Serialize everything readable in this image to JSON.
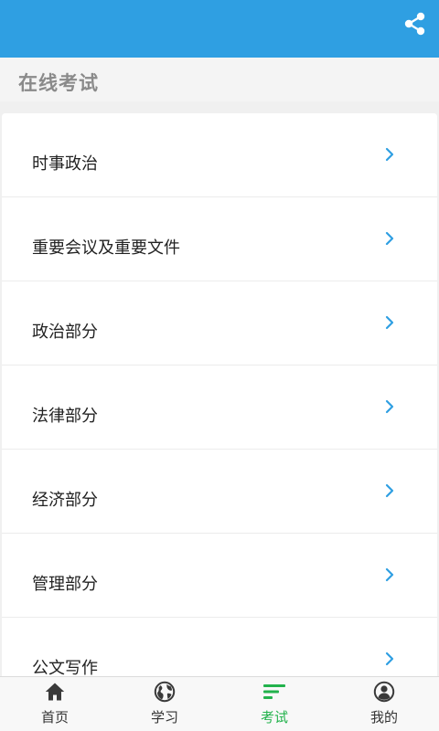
{
  "header": {
    "share_icon": "share-icon",
    "bar_color": "#2f9fe2"
  },
  "page": {
    "title": "在线考试"
  },
  "list": {
    "items": [
      {
        "label": "时事政治",
        "icon": "chevron-right-icon"
      },
      {
        "label": "重要会议及重要文件",
        "icon": "chevron-right-icon"
      },
      {
        "label": "政治部分",
        "icon": "chevron-right-icon"
      },
      {
        "label": "法律部分",
        "icon": "chevron-right-icon"
      },
      {
        "label": "经济部分",
        "icon": "chevron-right-icon"
      },
      {
        "label": "管理部分",
        "icon": "chevron-right-icon"
      },
      {
        "label": "公文写作",
        "icon": "chevron-right-icon"
      }
    ],
    "chevron_color": "#2f9fe2"
  },
  "nav": {
    "active_color": "#22b24c",
    "items": [
      {
        "label": "首页",
        "icon": "home-icon"
      },
      {
        "label": "学习",
        "icon": "globe-icon"
      },
      {
        "label": "考试",
        "icon": "list-icon",
        "active": true
      },
      {
        "label": "我的",
        "icon": "user-icon"
      }
    ]
  }
}
